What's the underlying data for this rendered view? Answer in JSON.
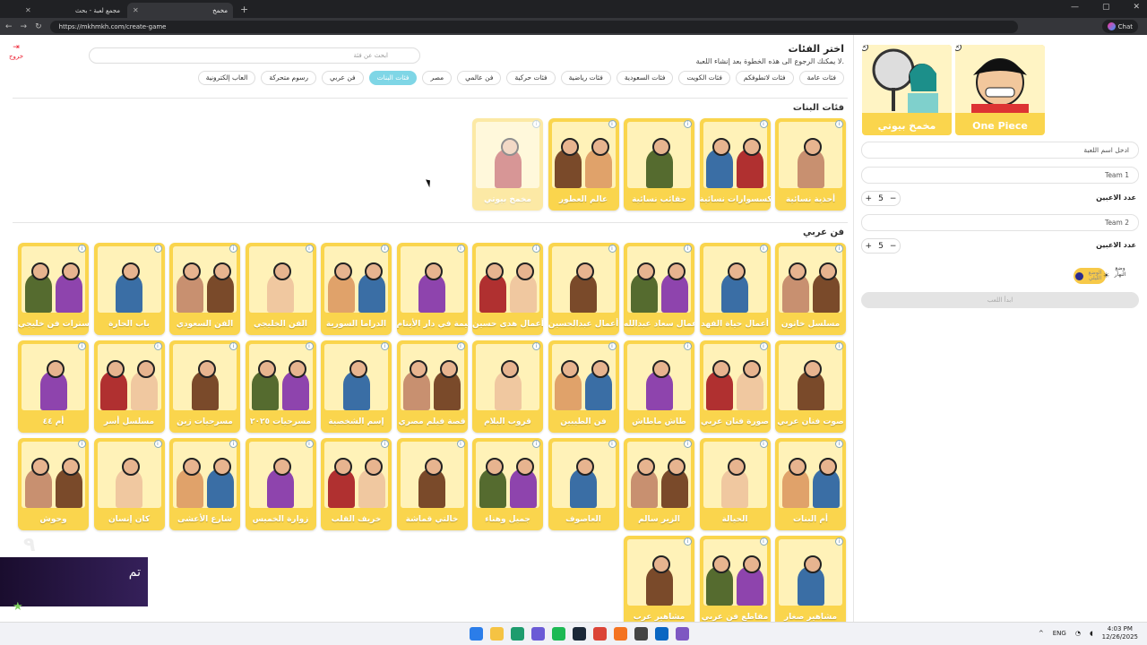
{
  "browser": {
    "tabs": [
      {
        "label": "مجمع لعبة - بحث"
      },
      {
        "label": "مخمخ"
      }
    ],
    "url": "https://mkhmkh.com/create-game",
    "chat_label": "Chat"
  },
  "header": {
    "exit_label": "خروج",
    "title": "اختر الفئات",
    "subtitle": "لا يمكنك الرجوع الى هذه الخطوة بعد إنشاء اللعبة.",
    "search_placeholder": "ابحث عن فئة"
  },
  "chips": [
    {
      "label": "فئات عامة",
      "active": false
    },
    {
      "label": "فئات لاتطوفكم",
      "active": false
    },
    {
      "label": "فئات الكويت",
      "active": false
    },
    {
      "label": "فئات السعودية",
      "active": false
    },
    {
      "label": "فئات رياضية",
      "active": false
    },
    {
      "label": "فئات حركية",
      "active": false
    },
    {
      "label": "فن عالمي",
      "active": false
    },
    {
      "label": "مصر",
      "active": false
    },
    {
      "label": "فئات البنات",
      "active": true
    },
    {
      "label": "فن عربي",
      "active": false
    },
    {
      "label": "رسوم متحركة",
      "active": false
    },
    {
      "label": "العاب إلكترونية",
      "active": false
    }
  ],
  "sections": [
    {
      "title": "فئات البنات",
      "cards": [
        {
          "label": "أحذية نسائية",
          "faded": false
        },
        {
          "label": "إكسسوارات نسائية",
          "faded": false
        },
        {
          "label": "حقائب نسائية",
          "faded": false
        },
        {
          "label": "عالم العطور",
          "faded": false
        },
        {
          "label": "مخمخ بيوتي",
          "faded": true
        }
      ]
    },
    {
      "title": "فن عربي",
      "cards": [
        {
          "label": "مسلسل خاتون"
        },
        {
          "label": "أعمال حياة الفهد"
        },
        {
          "label": "أعمال سعاد عبدالله"
        },
        {
          "label": "أعمال عبدالحسين"
        },
        {
          "label": "أعمال هدى حسين"
        },
        {
          "label": "أميمة في دار الأيتام"
        },
        {
          "label": "الدراما السورية"
        },
        {
          "label": "الفن الخليجي"
        },
        {
          "label": "الفن السعودي"
        },
        {
          "label": "باب الحارة"
        },
        {
          "label": "بوسترات فن خليجي"
        },
        {
          "label": "صوت فنان عربي"
        },
        {
          "label": "صورة فنان عربي"
        },
        {
          "label": "طاش ماطاش"
        },
        {
          "label": "فن الطيبين"
        },
        {
          "label": "قروب البلام"
        },
        {
          "label": "قصة فيلم مصري"
        },
        {
          "label": "إسم الشخصية"
        },
        {
          "label": "مسرحيات ٢٠٢٥"
        },
        {
          "label": "مسرحيات زين"
        },
        {
          "label": "مسلسل أسر"
        },
        {
          "label": "أم ٤٤"
        },
        {
          "label": "أم البنات"
        },
        {
          "label": "الحيالة"
        },
        {
          "label": "الزير سالم"
        },
        {
          "label": "العاصوف"
        },
        {
          "label": "جميل وهناء"
        },
        {
          "label": "خالتي قماشة"
        },
        {
          "label": "خريف القلب"
        },
        {
          "label": "زوارة الخميس"
        },
        {
          "label": "شارع الأعشى"
        },
        {
          "label": "كان إنسان"
        },
        {
          "label": "وحوش"
        },
        {
          "label": "مشاهير صغار"
        },
        {
          "label": "مقاطع فن عربي"
        },
        {
          "label": "مشاهير عرب"
        }
      ]
    }
  ],
  "selected": [
    {
      "label": "One Piece"
    },
    {
      "label": "مخمخ بيوتي"
    }
  ],
  "game_form": {
    "name_placeholder": "ادخل اسم اللعبة",
    "team1": "Team 1",
    "team2": "Team 2",
    "players_label": "عدد الاعبين",
    "team1_players": "5",
    "team2_players": "5",
    "mode_day": "وضع النهار",
    "mode_night": "الوضع الليلي",
    "start_label": "ابدأ اللعب"
  },
  "overlay_text": "تم",
  "taskbar": {
    "lang": "ENG",
    "time": "4:03 PM",
    "date": "12/26/2025"
  },
  "colors": {
    "card": "#fad54d",
    "chip_active": "#7fd6e6",
    "exit": "#e23333"
  }
}
